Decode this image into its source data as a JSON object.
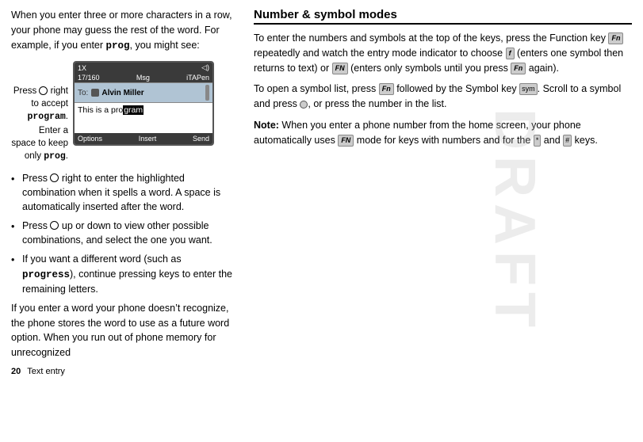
{
  "left": {
    "intro": "When you enter three or more characters in a row, your phone may guess the rest of the word. For example, if you enter ",
    "intro_bold": "prog",
    "intro_end": ", you might see:",
    "phone": {
      "status_left": "1X",
      "status_signal": "◁)",
      "counter": "17/160",
      "counter_mid": "Msg",
      "counter_right": "iTAPen",
      "to_label": "To:",
      "contact_name": "Alvin Miller",
      "message": "This is a pro",
      "message_highlight": "gram",
      "options": [
        "Options",
        "Insert",
        "Send"
      ]
    },
    "press_label_line1": "Press",
    "press_label_line2": " right",
    "press_label_line3": "to accept",
    "press_label_bold": "program",
    "press_label_line4": ". Enter a",
    "press_label_line5": "space to keep",
    "press_label_line6": "only ",
    "press_label_prog": "prog",
    "press_label_end": ".",
    "bullets": [
      {
        "text_parts": [
          {
            "text": "Press ",
            "bold": false
          },
          {
            "text": "CIRCLE",
            "bold": false,
            "icon": true
          },
          {
            "text": " right to enter the highlighted combination when it spells a word. A space is automatically inserted after the word.",
            "bold": false
          }
        ]
      },
      {
        "text_parts": [
          {
            "text": "Press ",
            "bold": false
          },
          {
            "text": "CIRCLE",
            "bold": false,
            "icon": true
          },
          {
            "text": " up or down to view other possible combinations, and select the one you want.",
            "bold": false
          }
        ]
      },
      {
        "text_parts": [
          {
            "text": "If you want a different word (such as ",
            "bold": false
          },
          {
            "text": "progress",
            "bold": true,
            "mono": true
          },
          {
            "text": "), continue pressing keys to enter the remaining letters.",
            "bold": false
          }
        ]
      }
    ],
    "bottom_text": "If you enter a word your phone doesn’t recognize, the phone stores the word to use as a future word option. When you run out of phone memory for unrecognized",
    "footer_page": "20",
    "footer_label": "Text entry"
  },
  "right": {
    "heading": "Number & symbol modes",
    "para1_start": "To enter the numbers and symbols at the top of the keys, press the Function key ",
    "para1_key1": "Fn",
    "para1_mid": " repeatedly and watch the entry mode indicator to choose ",
    "para1_f": "f",
    "para1_mid2": " (enters one symbol then returns to text) or ",
    "para1_fn": "FN",
    "para1_end": " (enters only symbols until you press ",
    "para1_key2": "Fn",
    "para1_end2": " again).",
    "para2_start": "To open a symbol list, press ",
    "para2_key1": "Fn",
    "para2_mid": " followed by the Symbol key ",
    "para2_sym": "sym",
    "para2_mid2": ". Scroll to a symbol and press ",
    "para2_center": "●",
    "para2_end": ", or press the number in the list.",
    "note_label": "Note:",
    "note_text": " When you enter a phone number from the home screen, your phone automatically uses ",
    "note_fn": "FN",
    "note_mid": " mode for keys with numbers and for the ",
    "note_star": "*",
    "note_and": " and ",
    "note_hash": "#",
    "note_end": " keys."
  }
}
